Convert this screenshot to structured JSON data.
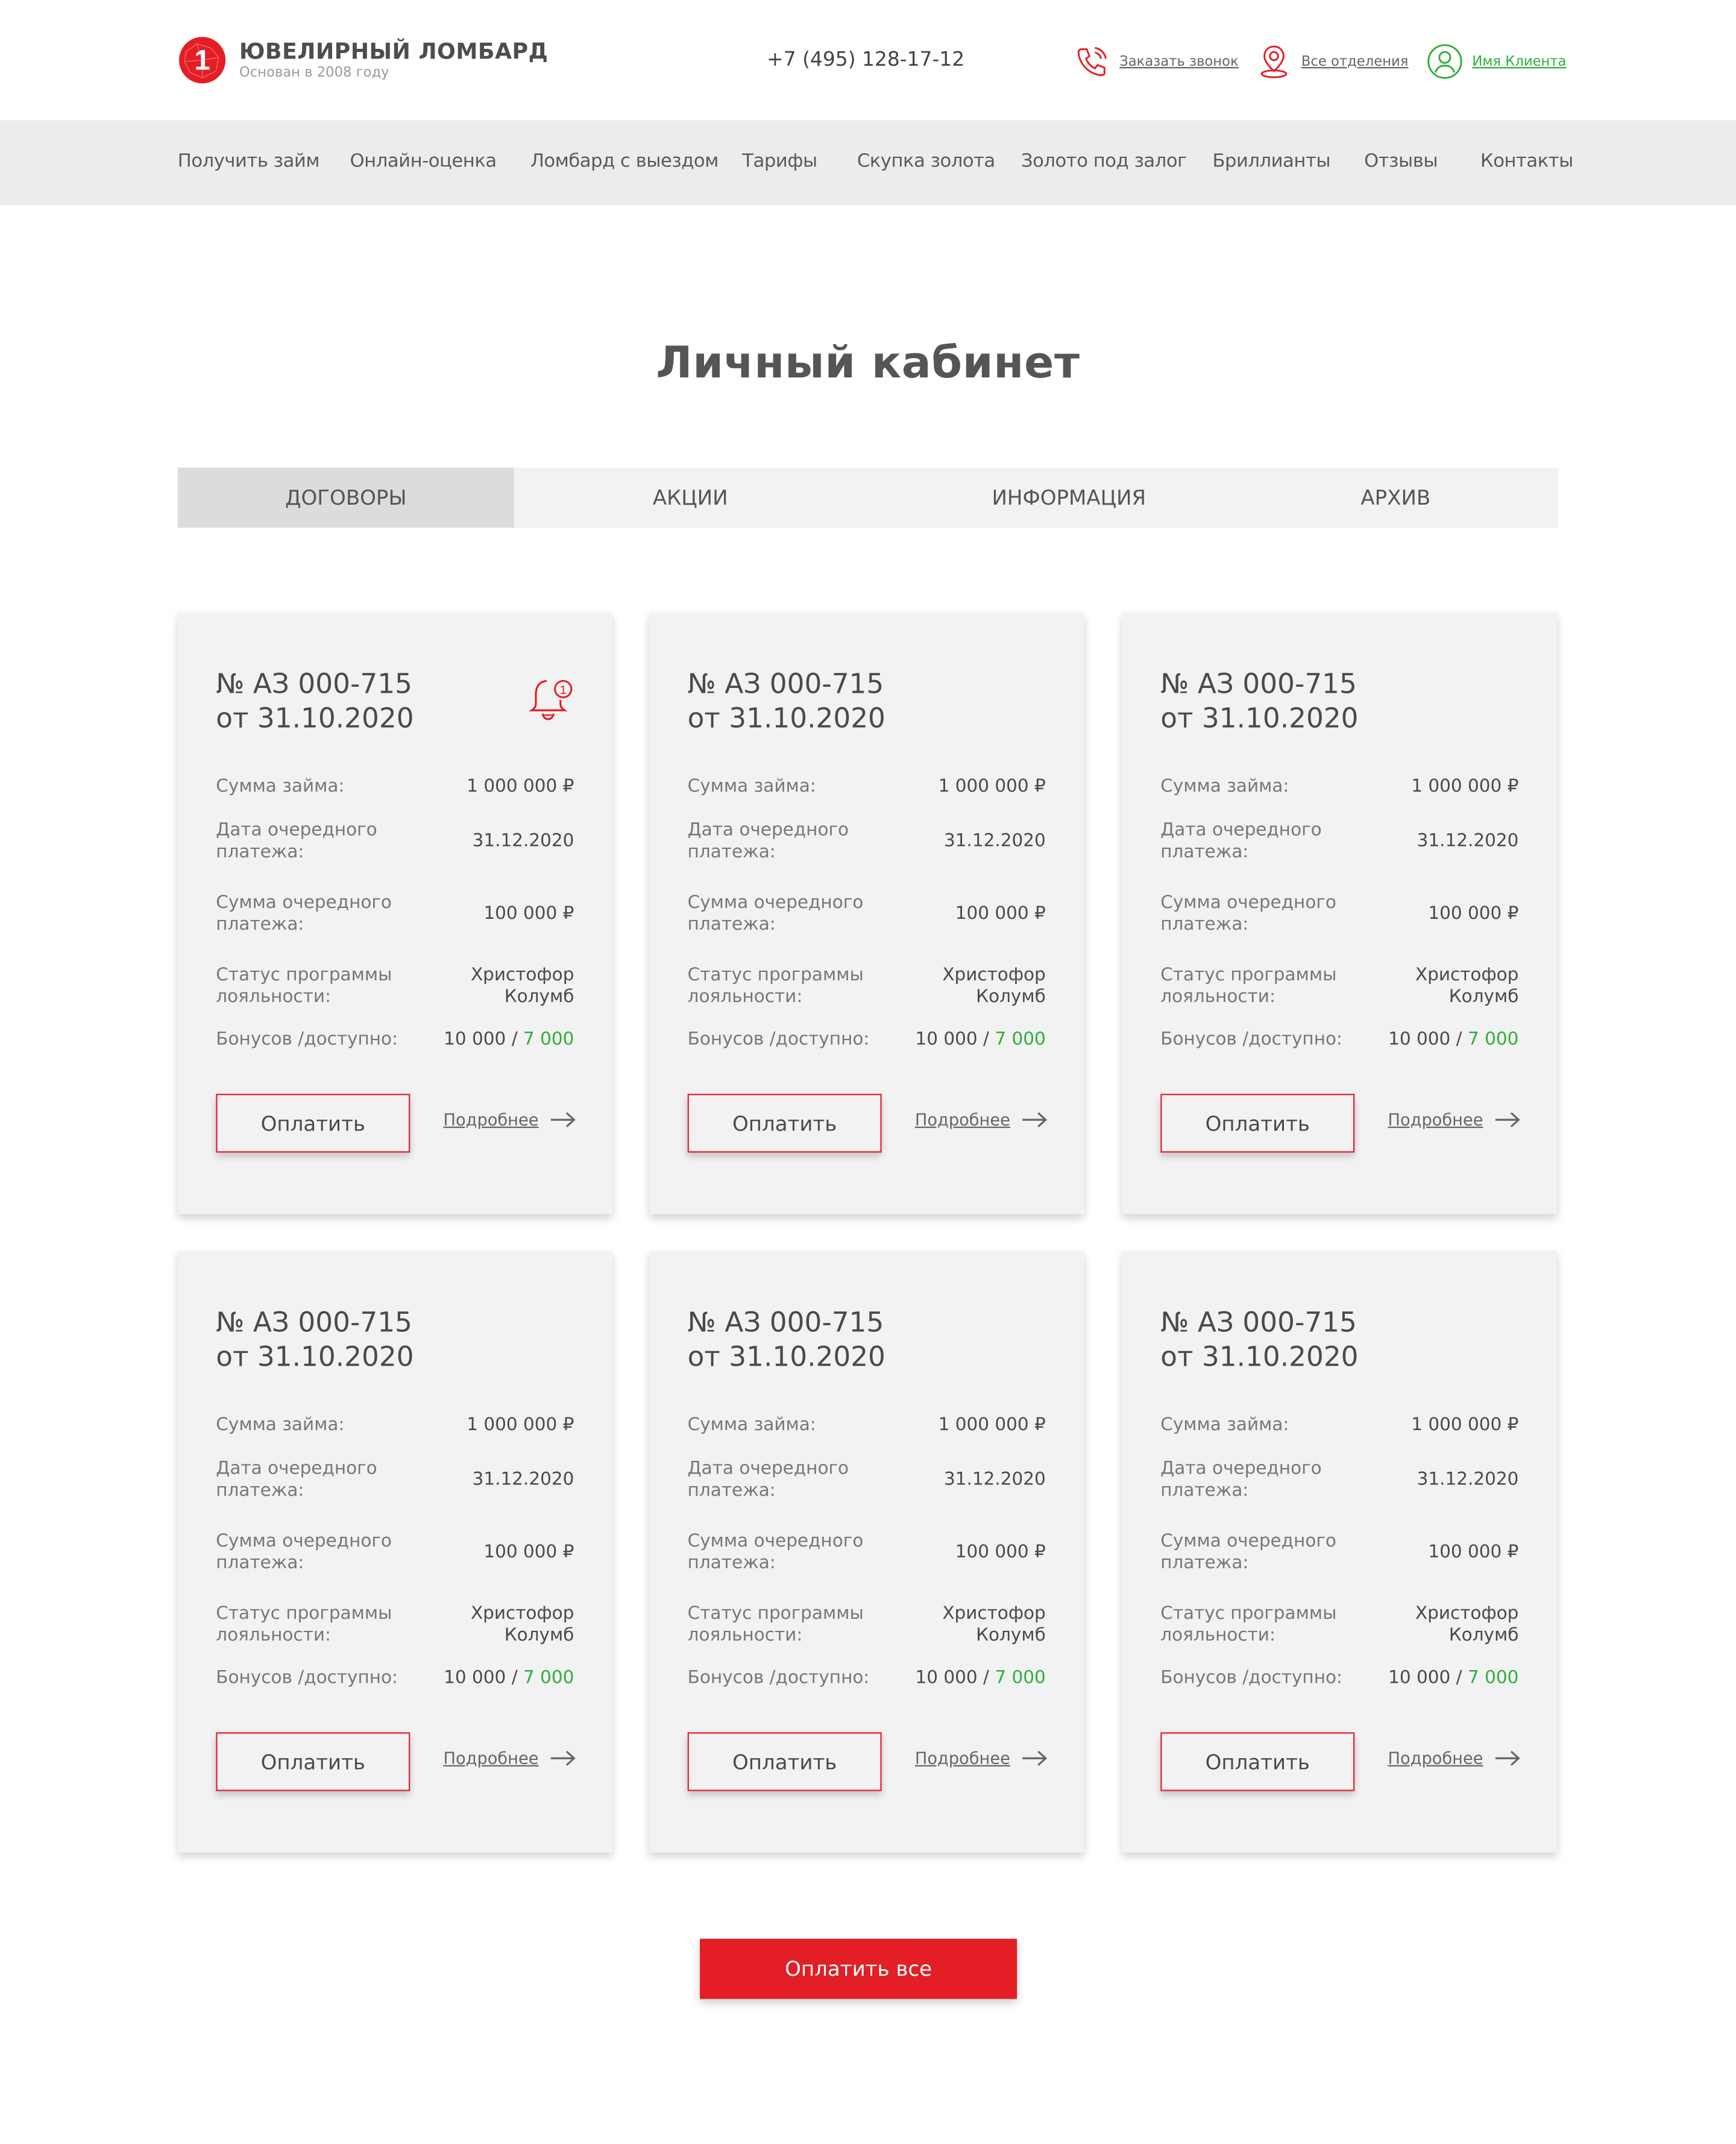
{
  "brand": {
    "title": "ЮВЕЛИРНЫЙ ЛОМБАРД",
    "subtitle": "Основан в 2008 году",
    "logo_digit": "1",
    "color": "#e31e25"
  },
  "header": {
    "phone": "+7 (495) 128-17-12",
    "callback": "Заказать звонок",
    "branches": "Все отделения",
    "client": "Имя Клиента"
  },
  "nav": {
    "items": [
      "Получить займ",
      "Онлайн-оценка",
      "Ломбард с выездом",
      "Тарифы",
      "Скупка золота",
      "Золото под залог",
      "Бриллианты",
      "Отзывы",
      "Контакты"
    ]
  },
  "page": {
    "title": "Личный кабинет"
  },
  "tabs": {
    "items": [
      "ДОГОВОРЫ",
      "АКЦИИ",
      "ИНФОРМАЦИЯ",
      "АРХИВ"
    ],
    "active": "ДОГОВОРЫ"
  },
  "labels": {
    "loan_sum": "Сумма займа:",
    "next_date": "Дата очередного платежа:",
    "next_sum": "Сумма очередного платежа:",
    "loyalty": "Статус программы лояльности:",
    "bonus": "Бонусов /доступно:",
    "pay": "Оплатить",
    "more": "Подробнее"
  },
  "contracts": [
    {
      "number": "№ АЗ 000-715",
      "date": "от 31.10.2020",
      "loan_sum": "1 000 000 ₽",
      "next_date": "31.12.2020",
      "next_sum": "100 000 ₽",
      "loyalty": "Христофор Колумб",
      "bonus": "10 000",
      "bonus_sep": " / ",
      "available": "7 000",
      "bell_count": "1"
    },
    {
      "number": "№ АЗ 000-715",
      "date": "от 31.10.2020",
      "loan_sum": "1 000 000 ₽",
      "next_date": "31.12.2020",
      "next_sum": "100 000 ₽",
      "loyalty": "Христофор Колумб",
      "bonus": "10 000",
      "bonus_sep": " / ",
      "available": "7 000"
    },
    {
      "number": "№ АЗ 000-715",
      "date": "от 31.10.2020",
      "loan_sum": "1 000 000 ₽",
      "next_date": "31.12.2020",
      "next_sum": "100 000 ₽",
      "loyalty": "Христофор Колумб",
      "bonus": "10 000",
      "bonus_sep": " / ",
      "available": "7 000"
    },
    {
      "number": "№ АЗ 000-715",
      "date": "от 31.10.2020",
      "loan_sum": "1 000 000 ₽",
      "next_date": "31.12.2020",
      "next_sum": "100 000 ₽",
      "loyalty": "Христофор Колумб",
      "bonus": "10 000",
      "bonus_sep": " / ",
      "available": "7 000"
    },
    {
      "number": "№ АЗ 000-715",
      "date": "от 31.10.2020",
      "loan_sum": "1 000 000 ₽",
      "next_date": "31.12.2020",
      "next_sum": "100 000 ₽",
      "loyalty": "Христофор Колумб",
      "bonus": "10 000",
      "bonus_sep": " / ",
      "available": "7 000"
    },
    {
      "number": "№ АЗ 000-715",
      "date": "от 31.10.2020",
      "loan_sum": "1 000 000 ₽",
      "next_date": "31.12.2020",
      "next_sum": "100 000 ₽",
      "loyalty": "Христофор Колумб",
      "bonus": "10 000",
      "bonus_sep": " / ",
      "available": "7 000"
    }
  ],
  "pay_all": "Оплатить все",
  "colors": {
    "accent": "#e31e25",
    "green": "#2fae3c",
    "nav_bg": "#ececec",
    "card_bg": "#f2f2f2"
  }
}
